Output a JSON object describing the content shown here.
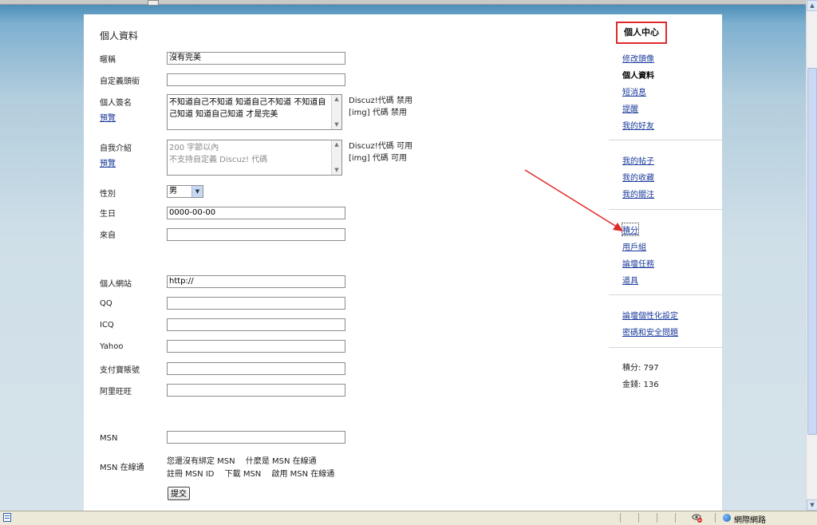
{
  "form": {
    "title": "個人資料",
    "nickname": {
      "label": "暱稱",
      "value": "沒有完美"
    },
    "custom_title": {
      "label": "自定義頭銜",
      "value": ""
    },
    "signature": {
      "label": "個人簽名",
      "preview": "預覽",
      "line1": "不知道自己不知道 知道自己不知道 不知道自",
      "line2": "己知道 知道自己知道 才是完美",
      "note1": "Discuz!代碼 禁用",
      "note2": "[img] 代碼 禁用"
    },
    "bio": {
      "label": "自我介紹",
      "preview": "預覽",
      "line1": "200 字節以內",
      "line2": "不支持自定義 Discuz! 代碼",
      "note1": "Discuz!代碼 可用",
      "note2": "[img] 代碼 可用"
    },
    "gender": {
      "label": "性別",
      "value": "男"
    },
    "birthday": {
      "label": "生日",
      "value": "0000-00-00"
    },
    "from": {
      "label": "來自",
      "value": ""
    },
    "website": {
      "label": "個人網站",
      "value": "http://"
    },
    "qq": {
      "label": "QQ",
      "value": ""
    },
    "icq": {
      "label": "ICQ",
      "value": ""
    },
    "yahoo": {
      "label": "Yahoo",
      "value": ""
    },
    "alipay": {
      "label": "支付寶賬號",
      "value": ""
    },
    "wangwang": {
      "label": "阿里旺旺",
      "value": ""
    },
    "msn": {
      "label": "MSN",
      "value": ""
    },
    "msn_online": {
      "label": "MSN 在線通",
      "row1": [
        "您還沒有綁定 MSN",
        "什麼是 MSN 在線通"
      ],
      "row2": [
        "註冊 MSN ID",
        "下載 MSN",
        "啟用 MSN 在線通"
      ]
    },
    "submit": "提交"
  },
  "sidebar": {
    "title": "個人中心",
    "group1": [
      "修改頭像",
      "個人資料",
      "短消息",
      "提醒",
      "我的好友"
    ],
    "group2": [
      "我的帖子",
      "我的收藏",
      "我的關注"
    ],
    "group3": [
      "積分",
      "用戶組",
      "論壇任務",
      "道具"
    ],
    "group4": [
      "論壇個性化設定",
      "密碼和安全問題"
    ],
    "credits": "積分: 797",
    "money": "金錢: 136"
  },
  "statusbar": {
    "zone": "網際網路"
  },
  "colors": {
    "highlight": "#e02a2a",
    "link": "#1a3a9a"
  }
}
